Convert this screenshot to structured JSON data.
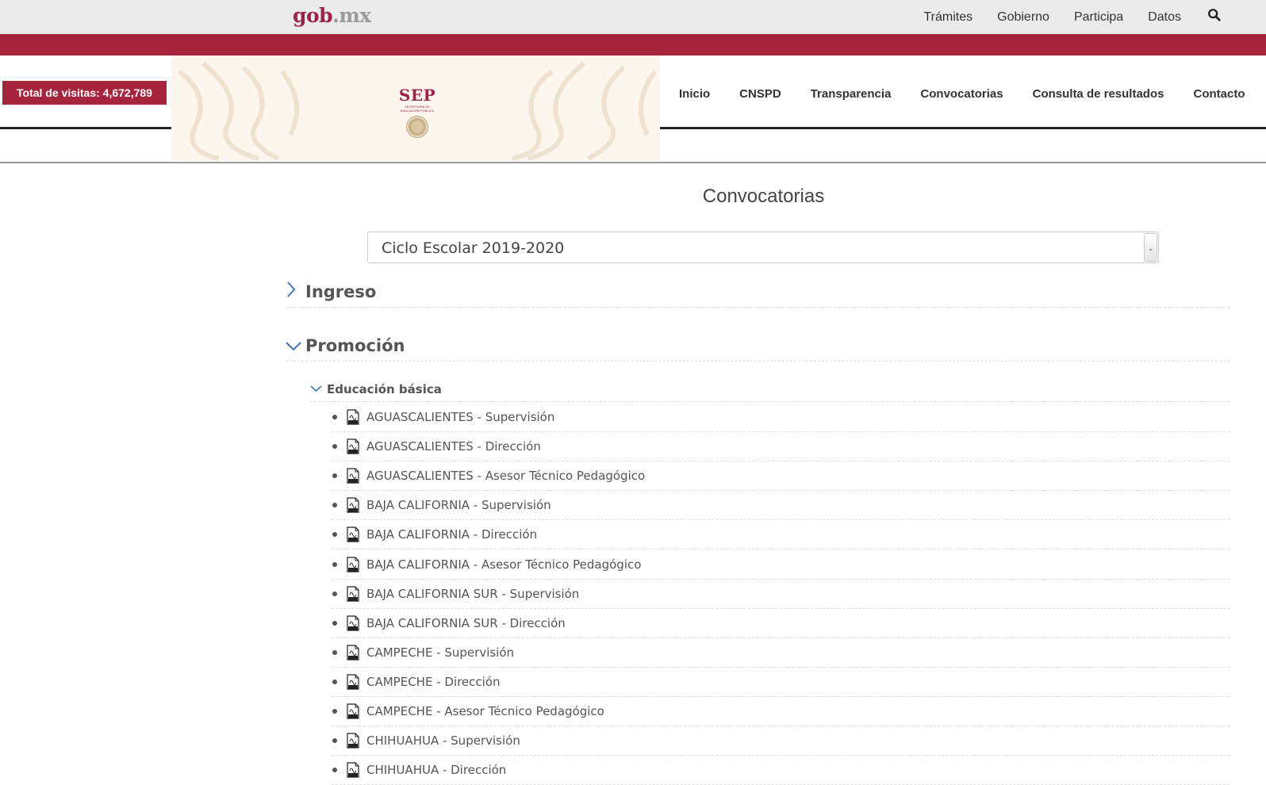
{
  "topbar": {
    "logo_gob": "gob",
    "logo_mx": ".mx",
    "nav": [
      "Trámites",
      "Gobierno",
      "Participa",
      "Datos"
    ]
  },
  "header": {
    "visits": "Total de visitas: 4,672,789",
    "sep": "SEP",
    "sep_sub1": "SECRETARÍA DE",
    "sep_sub2": "EDUCACIÓN PÚBLICA",
    "nav": [
      "Inicio",
      "CNSPD",
      "Transparencia",
      "Convocatorias",
      "Consulta de resultados",
      "Contacto"
    ]
  },
  "main": {
    "title": "Convocatorias",
    "select_value": "Ciclo Escolar 2019-2020",
    "sections": [
      "Ingreso",
      "Promoción"
    ],
    "subsection": "Educación básica",
    "items": [
      "AGUASCALIENTES - Supervisión",
      "AGUASCALIENTES - Dirección",
      "AGUASCALIENTES - Asesor Técnico Pedagógico",
      "BAJA CALIFORNIA - Supervisión",
      "BAJA CALIFORNIA - Dirección",
      "BAJA CALIFORNIA - Asesor Técnico Pedagógico",
      "BAJA CALIFORNIA SUR - Supervisión",
      "BAJA CALIFORNIA SUR - Dirección",
      "CAMPECHE - Supervisión",
      "CAMPECHE - Dirección",
      "CAMPECHE - Asesor Técnico Pedagógico",
      "CHIHUAHUA - Supervisión",
      "CHIHUAHUA - Dirección"
    ]
  },
  "colors": {
    "brand": "#a6243c",
    "accent": "#3f79b7"
  }
}
